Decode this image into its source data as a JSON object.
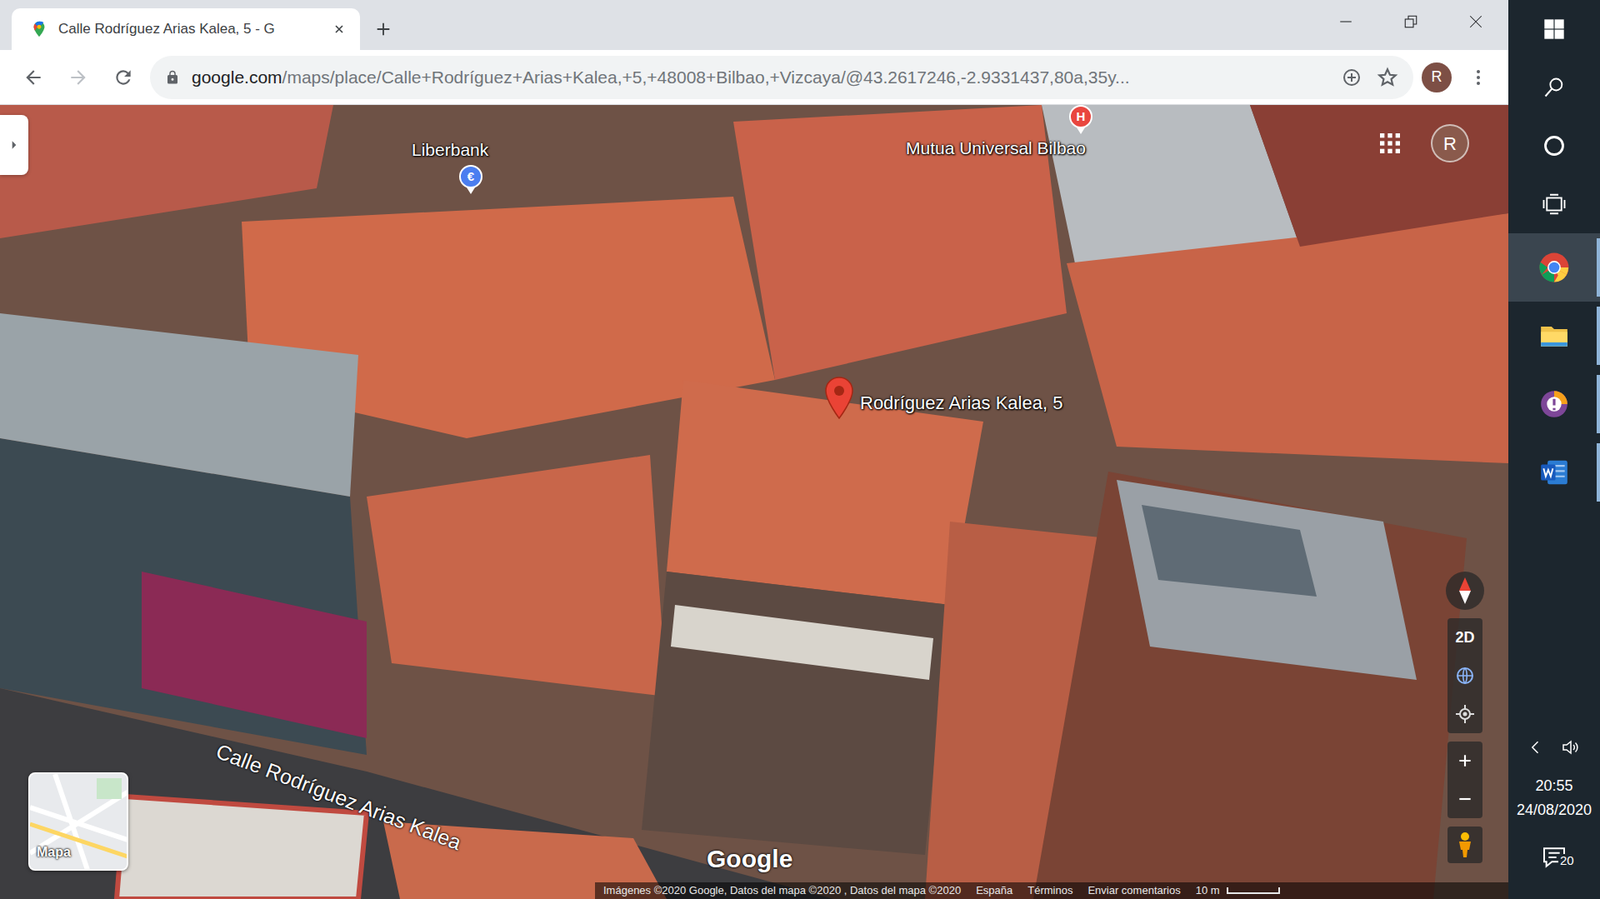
{
  "browser": {
    "tab": {
      "title": "Calle Rodríguez Arias Kalea, 5 - G",
      "selected": true
    },
    "nav": {
      "back_enabled": true,
      "forward_enabled": false
    },
    "url_host": "google.com",
    "url_path": "/maps/place/Calle+Rodríguez+Arias+Kalea,+5,+48008+Bilbao,+Vizcaya/@43.2617246,-2.9331437,80a,35y...",
    "bookmarked": false,
    "profile_initial": "R"
  },
  "map": {
    "places": [
      {
        "label": "Liberbank",
        "kind": "bank",
        "glyph": "€"
      },
      {
        "label": "Mutua Universal Bilbao",
        "kind": "hospital",
        "glyph": "H"
      },
      {
        "label": "Rodríguez Arias Kalea, 5",
        "kind": "selected"
      }
    ],
    "street_label": "Calle Rodríguez Arias Kalea",
    "account_initial": "R",
    "layer_switcher": "Mapa",
    "view_toggle": "2D",
    "logo": "Google",
    "footer": [
      "Imágenes ©2020 Google, Datos del mapa ©2020 , Datos del mapa ©2020",
      "España",
      "Términos",
      "Enviar comentarios"
    ],
    "scale": "10 m"
  },
  "taskbar": {
    "apps": [
      {
        "kind": "start",
        "running": false,
        "selected": false
      },
      {
        "kind": "search",
        "running": false,
        "selected": false
      },
      {
        "kind": "cortana",
        "running": false,
        "selected": false
      },
      {
        "kind": "task-view",
        "running": false,
        "selected": false
      },
      {
        "kind": "chrome",
        "running": true,
        "selected": true
      },
      {
        "kind": "explorer",
        "running": true,
        "selected": false
      },
      {
        "kind": "brave",
        "running": true,
        "selected": false
      },
      {
        "kind": "word",
        "running": true,
        "selected": false
      }
    ],
    "time": "20:55",
    "date": "24/08/2020",
    "notifications": "20"
  }
}
